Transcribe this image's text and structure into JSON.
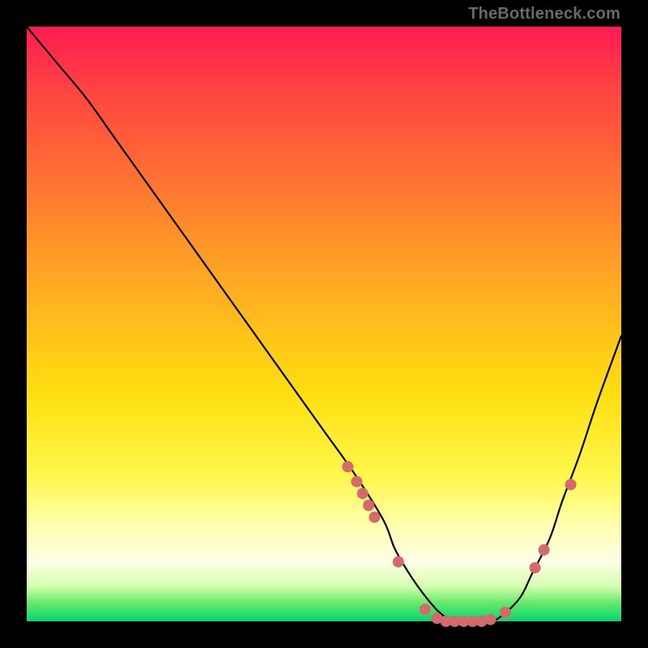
{
  "watermark": "TheBottleneck.com",
  "chart_data": {
    "type": "line",
    "title": "",
    "xlabel": "",
    "ylabel": "",
    "xlim": [
      0,
      100
    ],
    "ylim": [
      0,
      100
    ],
    "grid": false,
    "legend": false,
    "series": [
      {
        "name": "curve",
        "color": "#000000",
        "x": [
          0,
          5,
          10,
          15,
          20,
          25,
          30,
          35,
          40,
          45,
          50,
          55,
          60,
          62,
          65,
          68,
          70,
          72,
          75,
          78,
          80,
          83,
          85,
          88,
          90,
          93,
          96,
          100
        ],
        "values": [
          100,
          94,
          88,
          81,
          74,
          67,
          60,
          53,
          46,
          39,
          32,
          25,
          17,
          12,
          7,
          3,
          1,
          0,
          0,
          0,
          1,
          4,
          8,
          14,
          20,
          28,
          37,
          48
        ]
      }
    ],
    "markers": [
      {
        "x": 54.0,
        "y": 26.0
      },
      {
        "x": 55.5,
        "y": 23.5
      },
      {
        "x": 56.5,
        "y": 21.5
      },
      {
        "x": 57.5,
        "y": 19.5
      },
      {
        "x": 58.5,
        "y": 17.5
      },
      {
        "x": 62.5,
        "y": 10.0
      },
      {
        "x": 67.0,
        "y": 2.0
      },
      {
        "x": 69.0,
        "y": 0.5
      },
      {
        "x": 70.5,
        "y": 0.0
      },
      {
        "x": 72.0,
        "y": 0.0
      },
      {
        "x": 73.5,
        "y": 0.0
      },
      {
        "x": 75.0,
        "y": 0.0
      },
      {
        "x": 76.5,
        "y": 0.0
      },
      {
        "x": 78.0,
        "y": 0.3
      },
      {
        "x": 80.5,
        "y": 1.5
      },
      {
        "x": 85.5,
        "y": 9.0
      },
      {
        "x": 87.0,
        "y": 12.0
      },
      {
        "x": 91.5,
        "y": 23.0
      }
    ],
    "marker_color": "#d66a6a",
    "marker_radius_px": 7
  }
}
